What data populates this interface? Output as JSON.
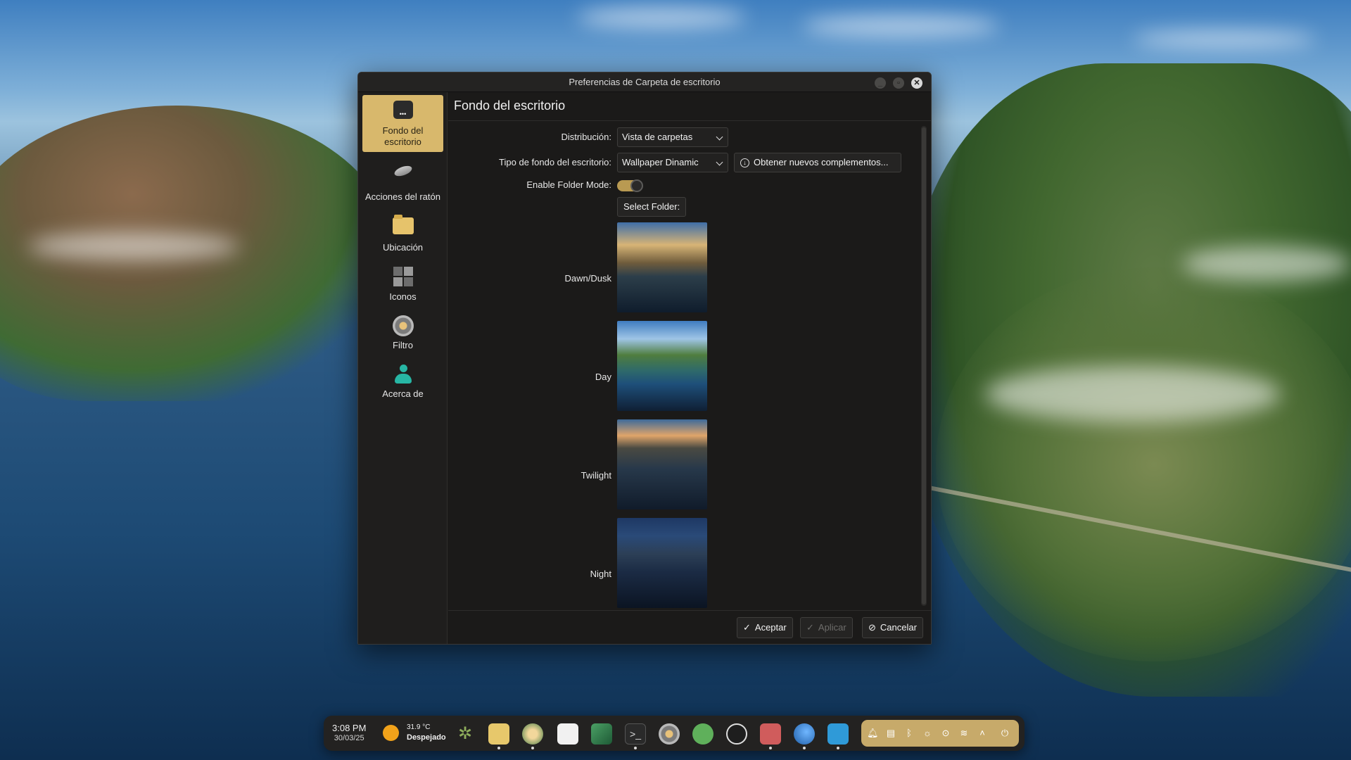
{
  "window": {
    "title": "Preferencias de Carpeta de escritorio",
    "controls": [
      "minimize-icon",
      "maximize-icon",
      "close-icon"
    ]
  },
  "sidebar": {
    "items": [
      {
        "label": "Fondo del escritorio",
        "icon": "wallpaper-icon",
        "active": true
      },
      {
        "label": "Acciones del ratón",
        "icon": "mouse-icon",
        "active": false
      },
      {
        "label": "Ubicación",
        "icon": "folder-icon",
        "active": false
      },
      {
        "label": "Iconos",
        "icon": "icons-grid-icon",
        "active": false
      },
      {
        "label": "Filtro",
        "icon": "filter-gear-icon",
        "active": false
      },
      {
        "label": "Acerca de",
        "icon": "user-icon",
        "active": false
      }
    ]
  },
  "main": {
    "title": "Fondo del escritorio",
    "layout_label": "Distribución:",
    "layout_value": "Vista de carpetas",
    "type_label": "Tipo de fondo del escritorio:",
    "type_value": "Wallpaper Dinamic",
    "get_new_label": "Obtener nuevos complementos...",
    "folder_mode_label": "Enable Folder Mode:",
    "folder_mode_on": true,
    "select_folder_label": "Select Folder:",
    "wallpapers": [
      {
        "label": "Dawn/Dusk"
      },
      {
        "label": "Day"
      },
      {
        "label": "Twilight"
      },
      {
        "label": "Night"
      }
    ]
  },
  "footer": {
    "accept_label": "Aceptar",
    "apply_label": "Aplicar",
    "cancel_label": "Cancelar"
  },
  "taskbar": {
    "time": "3:08 PM",
    "date": "30/03/25",
    "temperature": "31.9 °C",
    "condition": "Despejado",
    "apps": [
      "kde-icon",
      "file-manager-icon",
      "krita-icon",
      "store-icon",
      "image-viewer-icon",
      "terminal-icon",
      "settings-icon",
      "spotify-icon",
      "inkscape-icon",
      "audio-icon",
      "browser-icon",
      "remote-desktop-icon"
    ],
    "tray": [
      "notifications-icon",
      "clipboard-icon",
      "bluetooth-icon",
      "brightness-icon",
      "updates-icon",
      "wifi-icon",
      "expand-tray-icon",
      "power-icon"
    ]
  },
  "colors": {
    "accent": "#d8b86c",
    "window_bg": "#1b1a19",
    "tray_bg": "#c7aa6a"
  }
}
